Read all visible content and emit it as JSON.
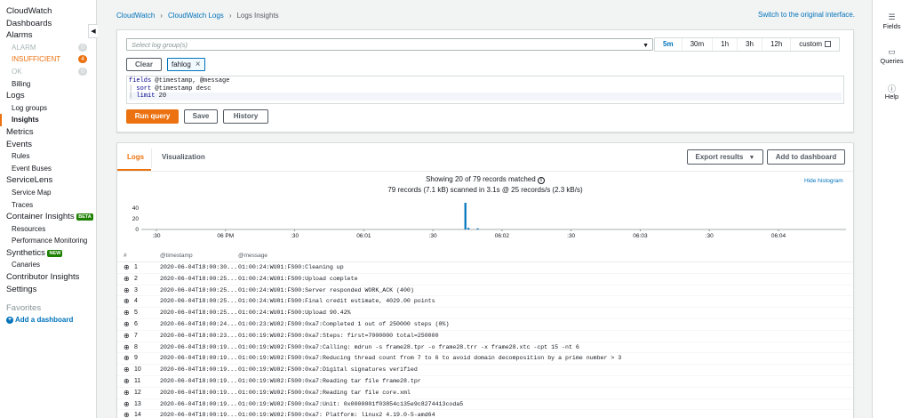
{
  "nav": {
    "cloudwatch": "CloudWatch",
    "dashboards": "Dashboards",
    "alarms": "Alarms",
    "alarm_states": [
      {
        "label": "ALARM",
        "count": "0"
      },
      {
        "label": "INSUFFICIENT",
        "count": "4"
      },
      {
        "label": "OK",
        "count": "0"
      }
    ],
    "billing": "Billing",
    "logs": "Logs",
    "log_groups": "Log groups",
    "insights": "Insights",
    "metrics": "Metrics",
    "events": "Events",
    "rules": "Rules",
    "event_buses": "Event Buses",
    "servicelens": "ServiceLens",
    "service_map": "Service Map",
    "traces": "Traces",
    "container_insights": "Container Insights",
    "beta": "BETA",
    "resources": "Resources",
    "performance_monitoring": "Performance Monitoring",
    "synthetics": "Synthetics",
    "new": "NEW",
    "canaries": "Canaries",
    "contributor_insights": "Contributor Insights",
    "settings": "Settings",
    "favorites": "Favorites",
    "add_dashboard": "Add a dashboard"
  },
  "rail": {
    "fields": "Fields",
    "queries": "Queries",
    "help": "Help"
  },
  "breadcrumb": [
    "CloudWatch",
    "CloudWatch Logs",
    "Logs Insights"
  ],
  "switch_link": "Switch to the original interface.",
  "query": {
    "log_group_placeholder": "Select log group(s)",
    "time_options": [
      "5m",
      "30m",
      "1h",
      "3h",
      "12h",
      "custom"
    ],
    "selected_time": "5m",
    "clear_label": "Clear",
    "chip_label": "fahlog",
    "lines": [
      {
        "kw": "fields",
        "rest": " @timestamp, @message"
      },
      {
        "kw": "sort",
        "rest": " @timestamp desc"
      },
      {
        "kw": "limit",
        "rest": " 20"
      }
    ],
    "run_label": "Run query",
    "save_label": "Save",
    "history_label": "History"
  },
  "results": {
    "tab_logs": "Logs",
    "tab_visualization": "Visualization",
    "export_label": "Export results",
    "dashboard_label": "Add to dashboard",
    "summary_line1": "Showing 20 of 79 records matched",
    "summary_line2": "79 records (7.1 kB) scanned in 3.1s @ 25 records/s (2.3 kB/s)",
    "hide_histogram": "Hide histogram"
  },
  "chart_data": {
    "type": "bar",
    "y_ticks": [
      "40",
      "20",
      "0"
    ],
    "ylim": [
      0,
      50
    ],
    "x_ticks": [
      ":30",
      "06 PM",
      ":30",
      "06:01",
      ":30",
      "06:02",
      ":30",
      "06:03",
      ":30",
      "06:04"
    ],
    "bars": [
      {
        "x": 0.4585,
        "value": 50
      },
      {
        "x": 0.4628,
        "value": 3
      },
      {
        "x": 0.476,
        "value": 2
      }
    ]
  },
  "table": {
    "headers": [
      "#",
      "@timestamp",
      "@message"
    ],
    "rows": [
      {
        "n": "1",
        "ts": "2020-06-04T18:00:30...",
        "msg": "01:00:24:WU01:FS00:Cleaning up"
      },
      {
        "n": "2",
        "ts": "2020-06-04T18:00:25...",
        "msg": "01:00:24:WU01:FS00:Upload complete"
      },
      {
        "n": "3",
        "ts": "2020-06-04T18:00:25...",
        "msg": "01:00:24:WU01:FS00:Server responded WORK_ACK (400)"
      },
      {
        "n": "4",
        "ts": "2020-06-04T18:00:25...",
        "msg": "01:00:24:WU01:FS00:Final credit estimate, 4029.00 points"
      },
      {
        "n": "5",
        "ts": "2020-06-04T18:00:25...",
        "msg": "01:00:24:WU01:FS00:Upload 90.42%"
      },
      {
        "n": "6",
        "ts": "2020-06-04T18:00:24...",
        "msg": "01:00:23:WU02:FS00:0xa7:Completed 1 out of 250000 steps (0%)"
      },
      {
        "n": "7",
        "ts": "2020-06-04T18:00:23...",
        "msg": "01:00:19:WU02:FS00:0xa7:Steps: first=7000000 total=250000"
      },
      {
        "n": "8",
        "ts": "2020-06-04T18:00:19...",
        "msg": "01:00:19:WU02:FS00:0xa7:Calling: mdrun -s frame28.tpr -o frame28.trr -x frame28.xtc -cpt 15 -nt 6"
      },
      {
        "n": "9",
        "ts": "2020-06-04T18:00:19...",
        "msg": "01:00:19:WU02:FS00:0xa7:Reducing thread count from 7 to 6 to avoid domain decomposition by a prime number > 3"
      },
      {
        "n": "10",
        "ts": "2020-06-04T18:00:19...",
        "msg": "01:00:19:WU02:FS00:0xa7:Digital signatures verified"
      },
      {
        "n": "11",
        "ts": "2020-06-04T18:00:19...",
        "msg": "01:00:19:WU02:FS00:0xa7:Reading tar file frame28.tpr"
      },
      {
        "n": "12",
        "ts": "2020-06-04T18:00:19...",
        "msg": "01:00:19:WU02:FS00:0xa7:Reading tar file core.xml"
      },
      {
        "n": "13",
        "ts": "2020-06-04T18:00:19...",
        "msg": "01:00:19:WU02:FS00:0xa7:Unit: 0x0000001f03854c135e9c8274413coda5"
      },
      {
        "n": "14",
        "ts": "2020-06-04T18:00:19...",
        "msg": "01:00:19:WU02:FS00:0xa7: Platform: linux2 4.19.0-5-amd64"
      }
    ]
  },
  "colors": {
    "accent": "#ec7211",
    "link": "#0073bb",
    "bar": "#0073bb"
  }
}
